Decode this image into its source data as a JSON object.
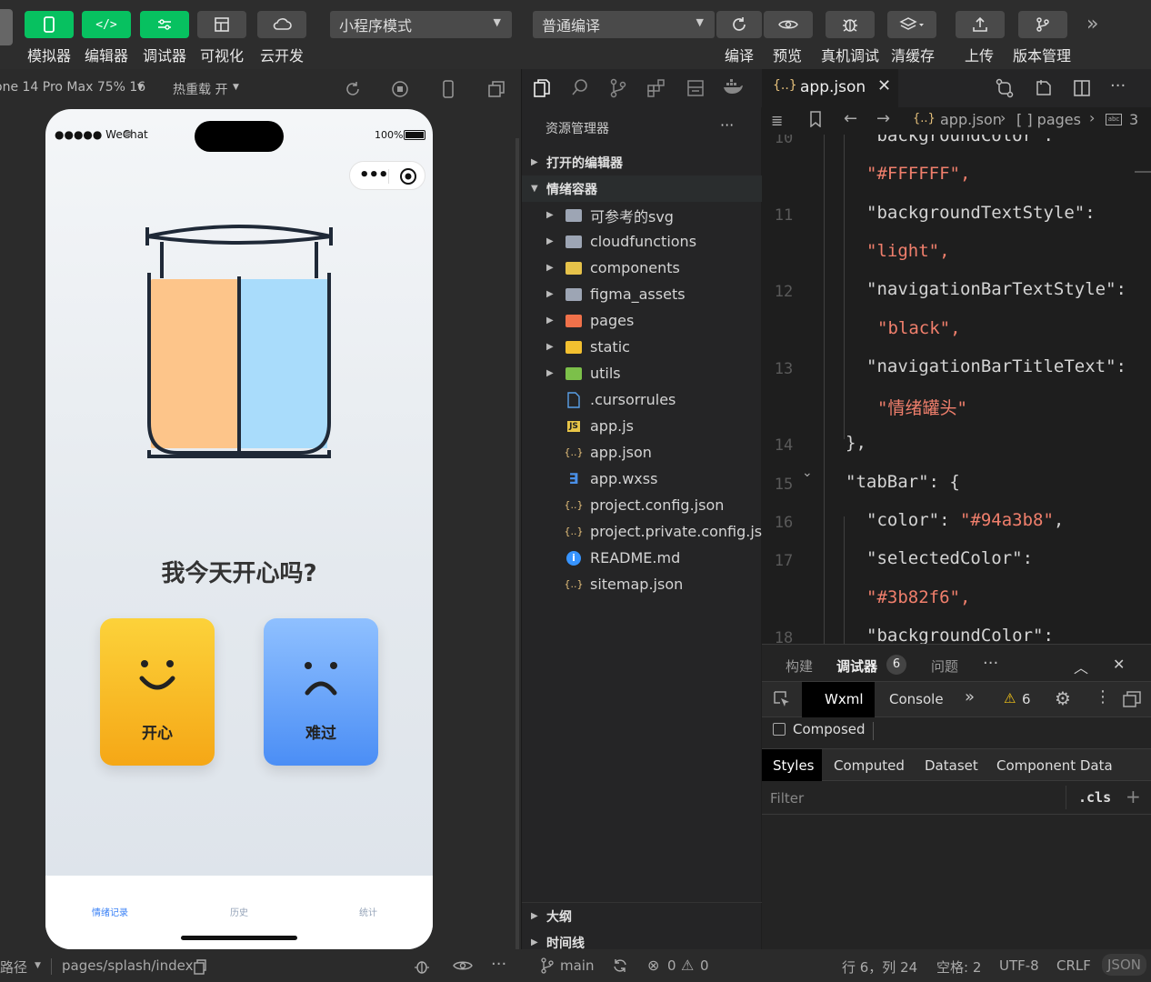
{
  "toolbar": {
    "left_buttons": [
      {
        "label": "模拟器",
        "icon": "phone-icon"
      },
      {
        "label": "编辑器",
        "icon": "code-icon"
      },
      {
        "label": "调试器",
        "icon": "debug-icon"
      },
      {
        "label": "可视化",
        "icon": "layout-icon"
      },
      {
        "label": "云开发",
        "icon": "cloud-icon"
      }
    ],
    "mode_select": "小程序模式",
    "compile_select": "普通编译",
    "right_buttons": [
      {
        "label": "编译",
        "icon": "refresh-icon"
      },
      {
        "label": "预览",
        "icon": "eye-icon"
      },
      {
        "label": "真机调试",
        "icon": "bug-icon"
      },
      {
        "label": "清缓存",
        "icon": "layers-icon"
      },
      {
        "label": "上传",
        "icon": "upload-icon"
      },
      {
        "label": "版本管理",
        "icon": "branch-icon"
      }
    ]
  },
  "simulator": {
    "device": "one 14 Pro Max 75% 16",
    "hot_reload": "热重载 开",
    "status_left": "●●●●● WeChat",
    "battery": "100%",
    "question": "我今天开心吗?",
    "happy_label": "开心",
    "sad_label": "难过",
    "tabs": [
      "情绪记录",
      "历史",
      "统计"
    ],
    "colors": {
      "tab_selected": "#3b82f6",
      "tab_color": "#94a3b8"
    }
  },
  "explorer": {
    "title": "资源管理器",
    "more": "···",
    "open_editors": "打开的编辑器",
    "project": "情绪容器",
    "items": [
      {
        "name": "可参考的svg",
        "type": "folder",
        "icon": "folder-icon"
      },
      {
        "name": "cloudfunctions",
        "type": "folder",
        "icon": "folder-icon"
      },
      {
        "name": "components",
        "type": "folder",
        "icon": "components-folder-icon"
      },
      {
        "name": "figma_assets",
        "type": "folder",
        "icon": "folder-icon"
      },
      {
        "name": "pages",
        "type": "folder",
        "icon": "pages-folder-icon"
      },
      {
        "name": "static",
        "type": "folder",
        "icon": "static-folder-icon"
      },
      {
        "name": "utils",
        "type": "folder",
        "icon": "utils-folder-icon"
      },
      {
        "name": ".cursorrules",
        "type": "file",
        "icon": "file-icon"
      },
      {
        "name": "app.js",
        "type": "file",
        "icon": "js-file-icon"
      },
      {
        "name": "app.json",
        "type": "file",
        "icon": "json-file-icon"
      },
      {
        "name": "app.wxss",
        "type": "file",
        "icon": "css-file-icon"
      },
      {
        "name": "project.config.json",
        "type": "file",
        "icon": "json-file-icon"
      },
      {
        "name": "project.private.config.js...",
        "type": "file",
        "icon": "json-file-icon"
      },
      {
        "name": "README.md",
        "type": "file",
        "icon": "info-file-icon"
      },
      {
        "name": "sitemap.json",
        "type": "file",
        "icon": "json-file-icon"
      }
    ],
    "outline": "大纲",
    "timeline": "时间线"
  },
  "editor": {
    "tab_name": "app.json",
    "breadcrumb": [
      "app.json",
      "[ ] pages",
      "3"
    ],
    "lines": [
      {
        "num": "10",
        "text": "\"backgroundColor\":",
        "kind": "k",
        "indent": 1
      },
      {
        "num": "",
        "text": "\"#FFFFFF\",",
        "kind": "s",
        "indent": 1
      },
      {
        "num": "11",
        "text": "\"backgroundTextStyle\":",
        "kind": "k",
        "indent": 1
      },
      {
        "num": "",
        "text": "\"light\",",
        "kind": "s",
        "indent": 1
      },
      {
        "num": "12",
        "text": "\"navigationBarTextStyle\":",
        "kind": "k",
        "indent": 1
      },
      {
        "num": "",
        "text": "\"black\",",
        "kind": "s",
        "indent": 2
      },
      {
        "num": "13",
        "text": "\"navigationBarTitleText\":",
        "kind": "k",
        "indent": 1
      },
      {
        "num": "",
        "text": "\"情绪罐头\"",
        "kind": "s",
        "indent": 2
      },
      {
        "num": "14",
        "text": "},",
        "kind": "k",
        "indent": 0
      },
      {
        "num": "15",
        "text": "\"tabBar\": {",
        "kind": "k",
        "indent": 0
      },
      {
        "num": "16",
        "text": "\"color\": \"#94a3b8\",",
        "kind": "mix",
        "indent": 1
      },
      {
        "num": "17",
        "text": "\"selectedColor\":",
        "kind": "k",
        "indent": 1
      },
      {
        "num": "",
        "text": "\"#3b82f6\",",
        "kind": "s",
        "indent": 1
      },
      {
        "num": "18",
        "text": "\"backgroundColor\":",
        "kind": "k",
        "indent": 1
      }
    ]
  },
  "devtools": {
    "tabs": [
      "构建",
      "调试器",
      "问题"
    ],
    "debugger_count": "6",
    "panel_tabs": [
      "Wxml",
      "Console"
    ],
    "warnings": "6",
    "composed": "Composed",
    "style_tabs": [
      "Styles",
      "Computed",
      "Dataset",
      "Component Data"
    ],
    "filter_placeholder": "Filter",
    "cls": ".cls"
  },
  "statusbar": {
    "path_label": "路径",
    "page_path": "pages/splash/index",
    "branch": "main",
    "errors": "0",
    "warnings": "0",
    "position": "行 6，列 24",
    "spaces": "空格: 2",
    "encoding": "UTF-8",
    "eol": "CRLF",
    "language": "JSON"
  }
}
